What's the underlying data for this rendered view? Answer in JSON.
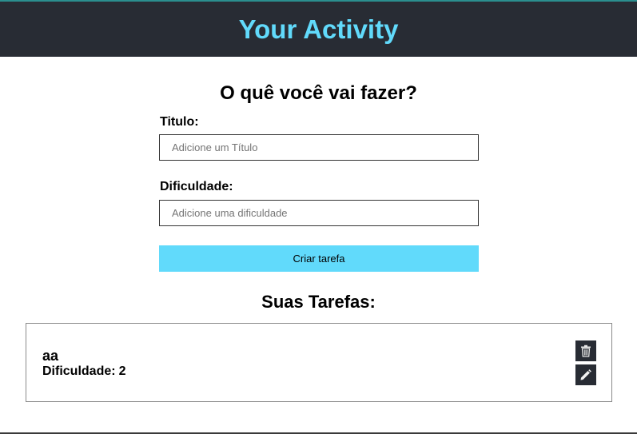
{
  "header": {
    "title": "Your Activity"
  },
  "form": {
    "title": "O quê você vai fazer?",
    "title_field": {
      "label": "Titulo:",
      "placeholder": "Adicione um Título",
      "value": ""
    },
    "difficulty_field": {
      "label": "Dificuldade:",
      "placeholder": "Adicione uma dificuldade",
      "value": ""
    },
    "submit_label": "Criar tarefa"
  },
  "tasks": {
    "title": "Suas Tarefas:",
    "items": [
      {
        "name": "aa",
        "difficulty_label": "Dificuldade:",
        "difficulty_value": "2",
        "delete_icon": "trash-icon",
        "edit_icon": "pencil-icon"
      }
    ]
  },
  "colors": {
    "header_bg": "#282c34",
    "accent": "#61dafb",
    "icon_button_bg": "#282c34"
  }
}
